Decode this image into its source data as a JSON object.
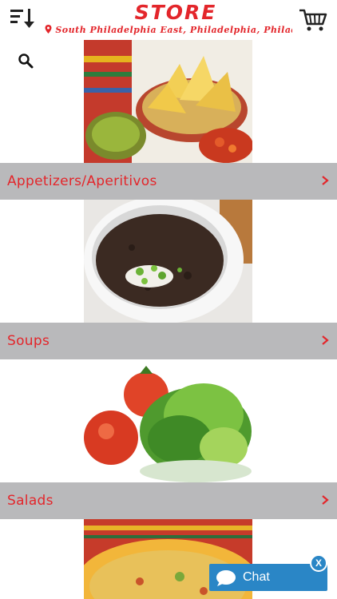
{
  "header": {
    "store_title": "STORE",
    "address": "South Philadelphia East, Philadelphia, Philadel",
    "menu_icon": "sort-descending-icon",
    "location_icon": "location-pin-icon",
    "cart_icon": "shopping-cart-icon",
    "search_icon": "search-icon"
  },
  "categories": [
    {
      "label": "Appetizers/Aperitivos",
      "image": "chips-guacamole-photo"
    },
    {
      "label": "Soups",
      "image": "black-bean-soup-photo"
    },
    {
      "label": "Salads",
      "image": "tomato-lettuce-salad-photo"
    },
    {
      "label": "",
      "image": "tortilla-soup-photo"
    }
  ],
  "chat": {
    "label": "Chat",
    "close_label": "X"
  },
  "colors": {
    "accent": "#e3262b",
    "bar": "#b9b9bb",
    "chat": "#2a86c6"
  }
}
